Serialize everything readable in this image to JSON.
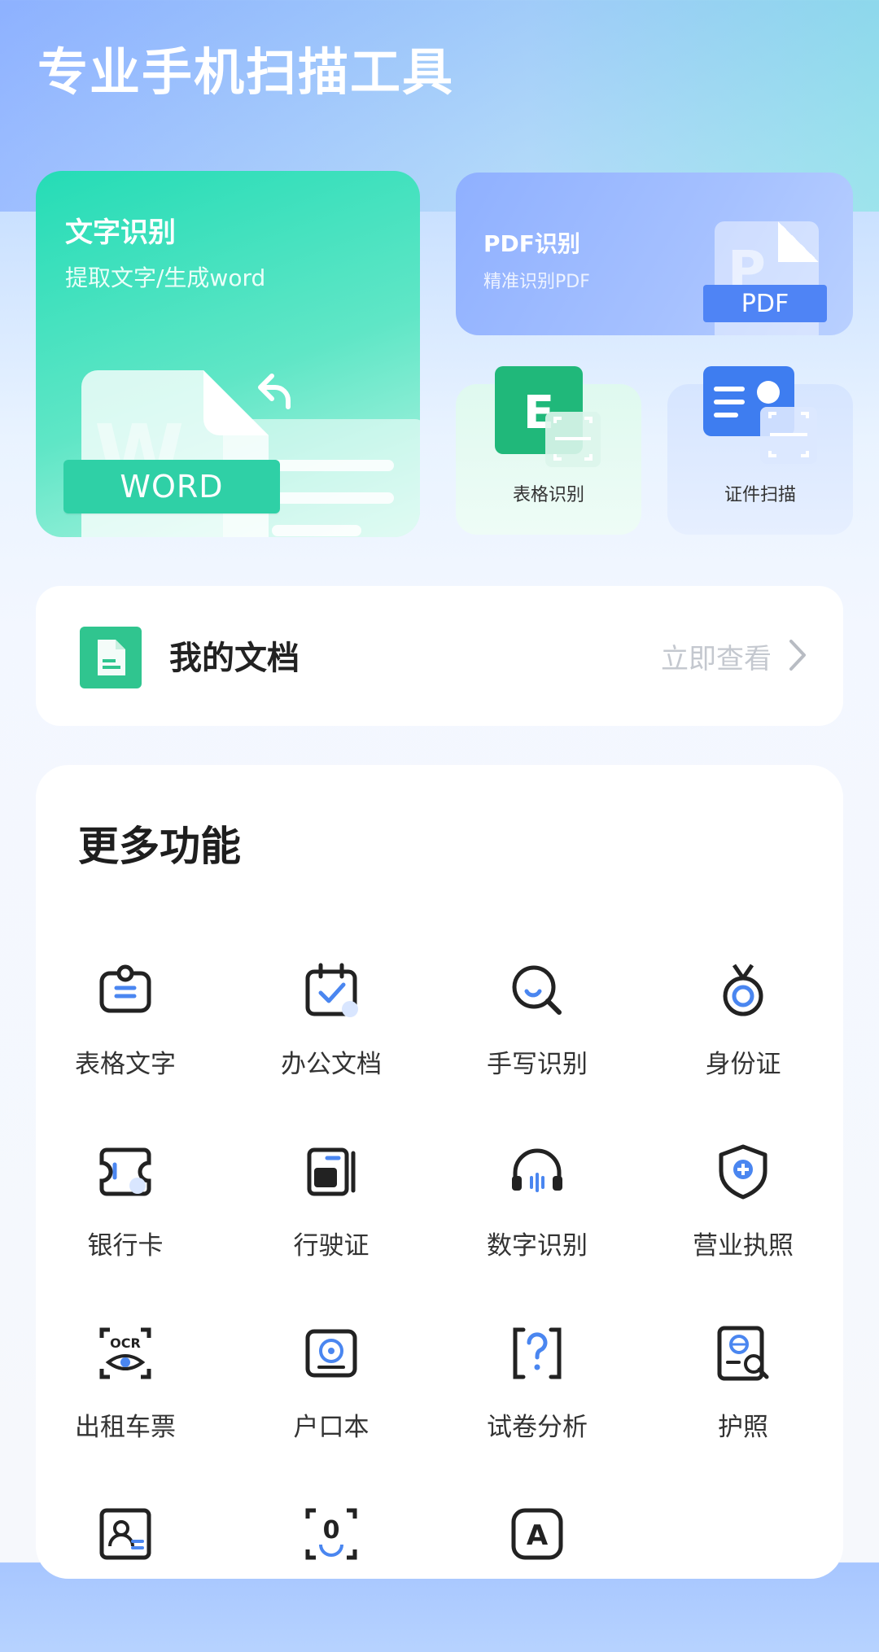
{
  "header": {
    "title": "专业手机扫描工具"
  },
  "cards": {
    "word": {
      "title": "文字识别",
      "subtitle": "提取文字/生成word",
      "badge": "WORD",
      "watermark": "W"
    },
    "pdf": {
      "title": "PDF识别",
      "subtitle": "精准识别PDF",
      "badge": "PDF",
      "watermark": "P"
    },
    "table": {
      "label": "表格识别",
      "icon_letter": "E"
    },
    "id": {
      "label": "证件扫描"
    }
  },
  "my_docs": {
    "title": "我的文档",
    "link": "立即查看"
  },
  "more": {
    "title": "更多功能",
    "items": [
      {
        "label": "表格文字",
        "icon": "badge-doc-icon"
      },
      {
        "label": "办公文档",
        "icon": "calendar-check-icon"
      },
      {
        "label": "手写识别",
        "icon": "magnifier-icon"
      },
      {
        "label": "身份证",
        "icon": "medal-icon"
      },
      {
        "label": "银行卡",
        "icon": "ticket-icon"
      },
      {
        "label": "行驶证",
        "icon": "vehicle-license-icon"
      },
      {
        "label": "数字识别",
        "icon": "headphones-icon"
      },
      {
        "label": "营业执照",
        "icon": "shield-plus-icon"
      },
      {
        "label": "出租车票",
        "icon": "ocr-eye-icon"
      },
      {
        "label": "户口本",
        "icon": "photo-frame-icon"
      },
      {
        "label": "试卷分析",
        "icon": "question-bracket-icon"
      },
      {
        "label": "护照",
        "icon": "passport-globe-icon"
      },
      {
        "label": "",
        "icon": "user-card-icon"
      },
      {
        "label": "",
        "icon": "mic-zero-icon"
      },
      {
        "label": "",
        "icon": "letter-a-icon"
      }
    ],
    "ocr_text": "OCR",
    "zero_text": "0",
    "a_text": "A"
  }
}
